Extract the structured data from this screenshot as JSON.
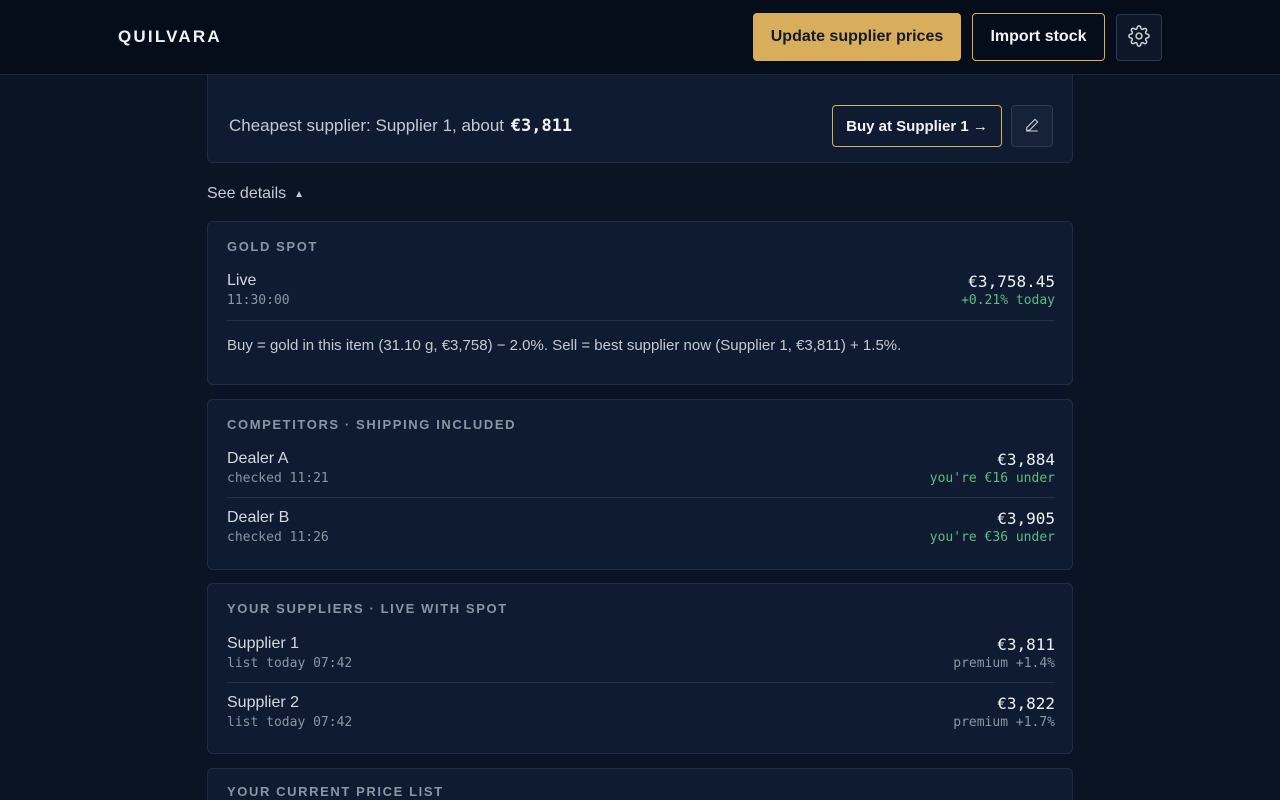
{
  "header": {
    "brand": "QUILVARA",
    "update_label": "Update supplier prices",
    "import_label": "Import stock",
    "settings_icon": "gear-icon"
  },
  "summary": {
    "cheapest_prefix": "Cheapest supplier: Supplier 1, about",
    "cheapest_amount": "€3,811",
    "buy_label": "Buy at Supplier 1 →",
    "edit_icon": "pencil-icon"
  },
  "details": {
    "toggle_label": "See details",
    "caret": "▲"
  },
  "gold_spot": {
    "title": "GOLD SPOT",
    "name": "Live",
    "time": "11:30:00",
    "price": "€3,758.45",
    "change": "+0.21% today",
    "note": "Buy = gold in this item (31.10 g, €3,758) − 2.0%. Sell = best supplier now (Supplier 1, €3,811) + 1.5%."
  },
  "competitors": {
    "title": "COMPETITORS · SHIPPING INCLUDED",
    "rows": [
      {
        "name": "Dealer A",
        "sub": "checked 11:21",
        "price": "€3,884",
        "note": "you're €16 under"
      },
      {
        "name": "Dealer B",
        "sub": "checked 11:26",
        "price": "€3,905",
        "note": "you're €36 under"
      }
    ]
  },
  "suppliers": {
    "title": "YOUR SUPPLIERS · LIVE WITH SPOT",
    "rows": [
      {
        "name": "Supplier 1",
        "sub": "list today 07:42",
        "price": "€3,811",
        "note": "premium +1.4%"
      },
      {
        "name": "Supplier 2",
        "sub": "list today 07:42",
        "price": "€3,822",
        "note": "premium +1.7%"
      }
    ]
  },
  "price_list": {
    "title": "YOUR CURRENT PRICE LIST"
  },
  "colors": {
    "background": "#0a1424",
    "accent_gold": "#d8ad5c",
    "positive_green": "#5dbb82"
  }
}
